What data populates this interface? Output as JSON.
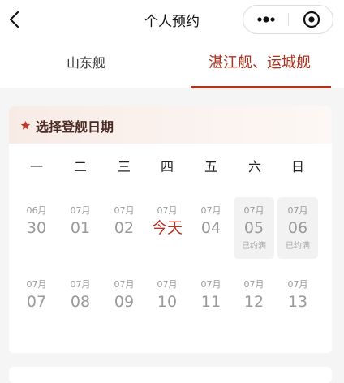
{
  "nav": {
    "title": "个人预约"
  },
  "tabs": [
    {
      "label": "山东舰",
      "active": false
    },
    {
      "label": "湛江舰、运城舰",
      "active": true
    }
  ],
  "colors": {
    "accent": "#b0321f",
    "background": "#f5f5f5"
  },
  "icons": [
    "back-arrow-icon",
    "more-dots-icon",
    "record-target-icon",
    "star-icon"
  ],
  "calendar": {
    "title": "选择登舰日期",
    "weekdays": [
      "一",
      "二",
      "三",
      "四",
      "五",
      "六",
      "日"
    ],
    "rows": [
      [
        {
          "month": "06月",
          "day": "30",
          "status": ""
        },
        {
          "month": "07月",
          "day": "01",
          "status": ""
        },
        {
          "month": "07月",
          "day": "02",
          "status": ""
        },
        {
          "month": "07月",
          "day": "今天",
          "status": "",
          "today": true
        },
        {
          "month": "07月",
          "day": "04",
          "status": ""
        },
        {
          "month": "07月",
          "day": "05",
          "status": "已约满",
          "full": true
        },
        {
          "month": "07月",
          "day": "06",
          "status": "已约满",
          "full": true
        }
      ],
      [
        {
          "month": "07月",
          "day": "07",
          "status": ""
        },
        {
          "month": "07月",
          "day": "08",
          "status": ""
        },
        {
          "month": "07月",
          "day": "09",
          "status": ""
        },
        {
          "month": "07月",
          "day": "10",
          "status": ""
        },
        {
          "month": "07月",
          "day": "11",
          "status": ""
        },
        {
          "month": "07月",
          "day": "12",
          "status": ""
        },
        {
          "month": "07月",
          "day": "13",
          "status": ""
        }
      ]
    ]
  }
}
